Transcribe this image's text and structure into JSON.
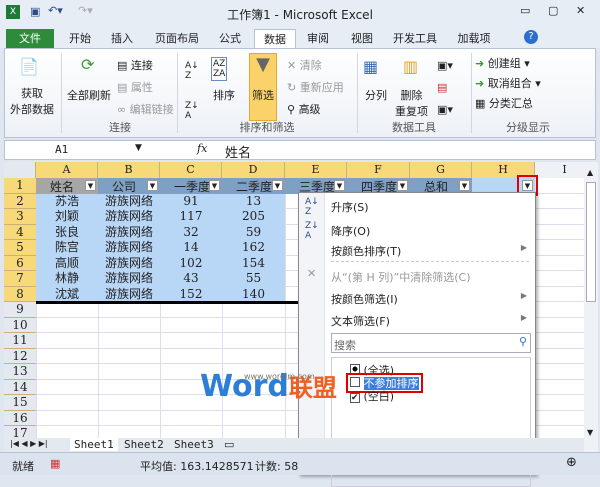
{
  "title": "工作簿1 - Microsoft Excel",
  "tabs": [
    "文件",
    "开始",
    "插入",
    "页面布局",
    "公式",
    "数据",
    "审阅",
    "视图",
    "开发工具",
    "加载项"
  ],
  "active_tab": "数据",
  "ribbon": {
    "get_external": "获取\n外部数据",
    "refresh_all": "全部刷新",
    "connections": "连接",
    "properties": "属性",
    "edit_links": "编辑链接",
    "group_conn": "连接",
    "sort": "排序",
    "filter": "筛选",
    "clear": "清除",
    "reapply": "重新应用",
    "advanced": "高级",
    "group_sort": "排序和筛选",
    "text_to_col": "分列",
    "remove_dup": "删除\n重复项",
    "group_tools": "数据工具",
    "group": "创建组",
    "ungroup": "取消组合",
    "subtotal": "分类汇总",
    "group_outline": "分级显示"
  },
  "formula_bar": {
    "name_box": "A1",
    "fx": "fx",
    "value": "姓名"
  },
  "columns": [
    "A",
    "B",
    "C",
    "D",
    "E",
    "F",
    "G",
    "H",
    "I"
  ],
  "headers": [
    "姓名",
    "公司",
    "一季度",
    "二季度",
    "三季度",
    "四季度",
    "总和",
    ""
  ],
  "rows": [
    [
      "苏浩",
      "游族网络",
      "91",
      "13"
    ],
    [
      "刘颖",
      "游族网络",
      "117",
      "205"
    ],
    [
      "张良",
      "游族网络",
      "32",
      "59"
    ],
    [
      "陈宫",
      "游族网络",
      "14",
      "162"
    ],
    [
      "高顺",
      "游族网络",
      "102",
      "154"
    ],
    [
      "林静",
      "游族网络",
      "43",
      "55"
    ],
    [
      "沈斌",
      "游族网络",
      "152",
      "140"
    ]
  ],
  "row_numbers": [
    "1",
    "2",
    "3",
    "4",
    "5",
    "6",
    "7",
    "8",
    "9",
    "10",
    "11",
    "12",
    "13",
    "14",
    "15",
    "16",
    "17"
  ],
  "menu": {
    "asc": "升序(S)",
    "desc": "降序(O)",
    "sort_color": "按颜色排序(T)",
    "clear_filter": "从“(第 H 列)”中清除筛选(C)",
    "filter_color": "按颜色筛选(I)",
    "text_filter": "文本筛选(F)",
    "search_placeholder": "搜索",
    "items": [
      {
        "label": "(全选)",
        "state": "partial"
      },
      {
        "label": "不参加排序",
        "state": "unchecked"
      },
      {
        "label": "(空白)",
        "state": "checked"
      }
    ]
  },
  "sheets": [
    "Sheet1",
    "Sheet2",
    "Sheet3"
  ],
  "status": {
    "ready": "就绪",
    "average": "平均值: 163.1428571",
    "count": "计数: 58"
  },
  "watermark": {
    "word": "Word",
    "cn": "联盟",
    "url": "www.wordlm.com"
  },
  "colors": {
    "header_fill": "#7f9fc4",
    "selection": "#b8d6f5",
    "accent": "#2e8b3a",
    "highlight": "#e00000"
  }
}
